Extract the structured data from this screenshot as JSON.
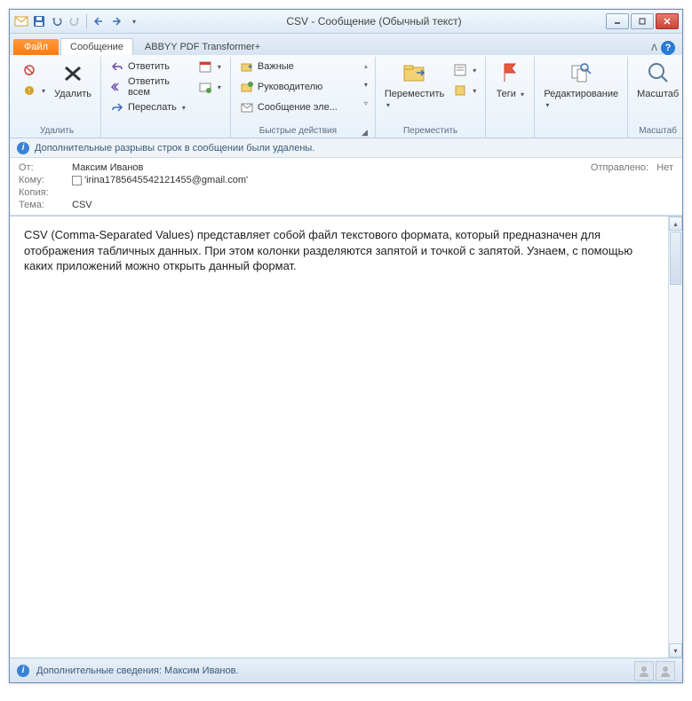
{
  "title": "CSV  -  Сообщение (Обычный текст)",
  "tabs": {
    "file": "Файл",
    "message": "Сообщение",
    "abbyy": "ABBYY PDF Transformer+"
  },
  "ribbon": {
    "delete": {
      "label": "Удалить",
      "big": "Удалить"
    },
    "respond": {
      "reply": "Ответить",
      "reply_all": "Ответить всем",
      "forward": "Переслать"
    },
    "quick_actions": {
      "important": "Важные",
      "to_manager": "Руководителю",
      "team_email": "Сообщение эле...",
      "label": "Быстрые действия"
    },
    "move": {
      "big": "Переместить",
      "label": "Переместить"
    },
    "tags": {
      "big": "Теги",
      "label": ""
    },
    "editing": {
      "big": "Редактирование",
      "label": ""
    },
    "zoom": {
      "big": "Масштаб",
      "label": "Масштаб"
    }
  },
  "notice": "Дополнительные разрывы строк в сообщении были удалены.",
  "headers": {
    "from_lbl": "От:",
    "from": "Максим Иванов",
    "to_lbl": "Кому:",
    "to": "'irina1785645542121455@gmail.com'",
    "cc_lbl": "Копия:",
    "cc": "",
    "subj_lbl": "Тема:",
    "subj": "CSV",
    "sent_lbl": "Отправлено:",
    "sent": "Нет"
  },
  "body": "CSV (Comma-Separated Values) представляет собой файл текстового формата, который предназначен для отображения табличных данных. При этом колонки разделяются запятой и точкой с запятой. Узнаем, с помощью каких приложений можно открыть данный формат.",
  "status": "Дополнительные сведения: Максим Иванов."
}
